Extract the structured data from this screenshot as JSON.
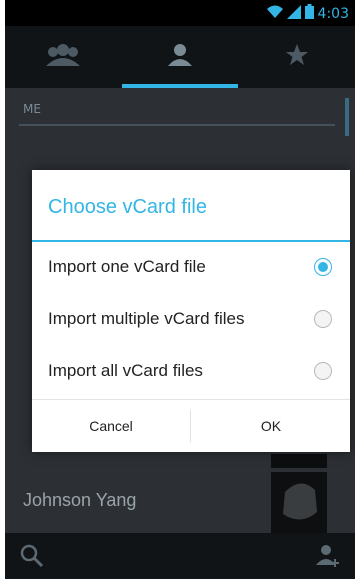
{
  "status": {
    "time": "4:03",
    "icons": [
      "wifi-icon",
      "signal-icon",
      "battery-icon"
    ]
  },
  "tabs": [
    {
      "name": "groups",
      "icon": "groups-icon",
      "selected": false
    },
    {
      "name": "contacts",
      "icon": "person-icon",
      "selected": true
    },
    {
      "name": "favorites",
      "icon": "star-icon",
      "selected": false
    }
  ],
  "list": {
    "section_header": "ME",
    "bottom_contact": "Johnson Yang"
  },
  "bottom_bar": {
    "left_icon": "search-icon",
    "right_icon": "add-contact-icon"
  },
  "dialog": {
    "title": "Choose vCard file",
    "options": [
      {
        "label": "Import one vCard file",
        "checked": true
      },
      {
        "label": "Import multiple vCard files",
        "checked": false
      },
      {
        "label": "Import all vCard files",
        "checked": false
      }
    ],
    "cancel_label": "Cancel",
    "ok_label": "OK"
  },
  "colors": {
    "accent": "#33b5e5",
    "dim_background": "#2c3034",
    "bar": "#111416"
  }
}
